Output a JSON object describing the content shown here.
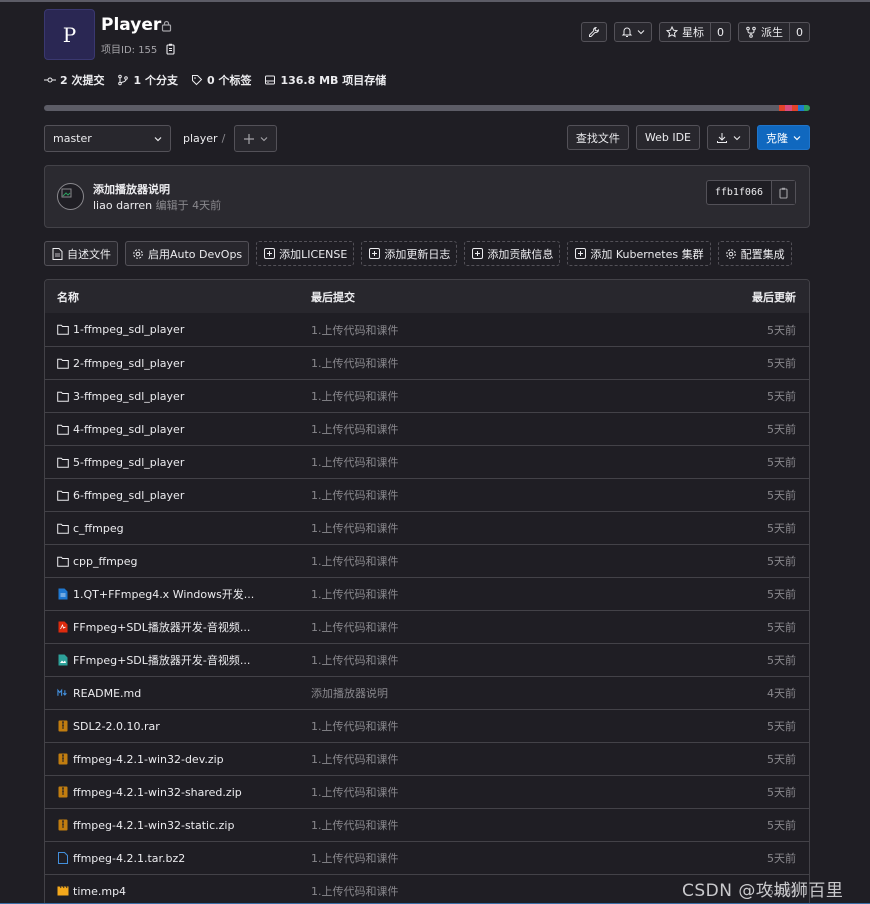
{
  "project": {
    "avatar_letter": "P",
    "title": "Player",
    "project_id": "项目ID: 155"
  },
  "header_buttons": {
    "star_label": "星标",
    "star_count": "0",
    "fork_label": "派生",
    "fork_count": "0"
  },
  "stats": [
    {
      "value": "2 次提交",
      "icon": "commit-icon"
    },
    {
      "value": "1 个分支",
      "icon": "branch-icon"
    },
    {
      "value": "0 个标签",
      "icon": "tag-icon"
    },
    {
      "value": "136.8 MB 项目存储",
      "icon": "storage-icon"
    }
  ],
  "language_bar_colors": [
    "#5c5c66",
    "#e24329",
    "#d94c7f",
    "#1f78d1",
    "#2da160"
  ],
  "toolbar": {
    "branch": "master",
    "path": "player",
    "path_sep": "/",
    "find_file": "查找文件",
    "web_ide": "Web IDE",
    "clone": "克隆"
  },
  "commit": {
    "title": "添加播放器说明",
    "author": "liao darren",
    "edited": "编辑于 4天前",
    "sha": "ffb1f066"
  },
  "quick_actions": [
    {
      "label": "自述文件",
      "icon": "file-icon",
      "dashed": false
    },
    {
      "label": "启用Auto DevOps",
      "icon": "gear-icon",
      "dashed": false
    },
    {
      "label": "添加LICENSE",
      "icon": "plus-square-icon",
      "dashed": true
    },
    {
      "label": "添加更新日志",
      "icon": "plus-square-icon",
      "dashed": true
    },
    {
      "label": "添加贡献信息",
      "icon": "plus-square-icon",
      "dashed": true
    },
    {
      "label": "添加 Kubernetes 集群",
      "icon": "plus-square-icon",
      "dashed": true
    },
    {
      "label": "配置集成",
      "icon": "gear-icon",
      "dashed": true
    }
  ],
  "table": {
    "headers": {
      "name": "名称",
      "last_commit": "最后提交",
      "last_update": "最后更新"
    },
    "rows": [
      {
        "name": "1-ffmpeg_sdl_player",
        "type": "folder",
        "commit": "1.上传代码和课件",
        "updated": "5天前"
      },
      {
        "name": "2-ffmpeg_sdl_player",
        "type": "folder",
        "commit": "1.上传代码和课件",
        "updated": "5天前"
      },
      {
        "name": "3-ffmpeg_sdl_player",
        "type": "folder",
        "commit": "1.上传代码和课件",
        "updated": "5天前"
      },
      {
        "name": "4-ffmpeg_sdl_player",
        "type": "folder",
        "commit": "1.上传代码和课件",
        "updated": "5天前"
      },
      {
        "name": "5-ffmpeg_sdl_player",
        "type": "folder",
        "commit": "1.上传代码和课件",
        "updated": "5天前"
      },
      {
        "name": "6-ffmpeg_sdl_player",
        "type": "folder",
        "commit": "1.上传代码和课件",
        "updated": "5天前"
      },
      {
        "name": "c_ffmpeg",
        "type": "folder",
        "commit": "1.上传代码和课件",
        "updated": "5天前"
      },
      {
        "name": "cpp_ffmpeg",
        "type": "folder",
        "commit": "1.上传代码和课件",
        "updated": "5天前"
      },
      {
        "name": "1.QT+FFmpeg4.x Windows开发...",
        "type": "doc",
        "commit": "1.上传代码和课件",
        "updated": "5天前"
      },
      {
        "name": "FFmpeg+SDL播放器开发-音视频...",
        "type": "pdf",
        "commit": "1.上传代码和课件",
        "updated": "5天前"
      },
      {
        "name": "FFmpeg+SDL播放器开发-音视频...",
        "type": "image",
        "commit": "1.上传代码和课件",
        "updated": "5天前"
      },
      {
        "name": "README.md",
        "type": "markdown",
        "commit": "添加播放器说明",
        "updated": "4天前"
      },
      {
        "name": "SDL2-2.0.10.rar",
        "type": "archive",
        "commit": "1.上传代码和课件",
        "updated": "5天前"
      },
      {
        "name": "ffmpeg-4.2.1-win32-dev.zip",
        "type": "archive",
        "commit": "1.上传代码和课件",
        "updated": "5天前"
      },
      {
        "name": "ffmpeg-4.2.1-win32-shared.zip",
        "type": "archive",
        "commit": "1.上传代码和课件",
        "updated": "5天前"
      },
      {
        "name": "ffmpeg-4.2.1-win32-static.zip",
        "type": "archive",
        "commit": "1.上传代码和课件",
        "updated": "5天前"
      },
      {
        "name": "ffmpeg-4.2.1.tar.bz2",
        "type": "file",
        "commit": "1.上传代码和课件",
        "updated": "5天前"
      },
      {
        "name": "time.mp4",
        "type": "video",
        "commit": "1.上传代码和课件",
        "updated": "5天前"
      }
    ]
  },
  "watermark": "CSDN @攻城狮百里"
}
